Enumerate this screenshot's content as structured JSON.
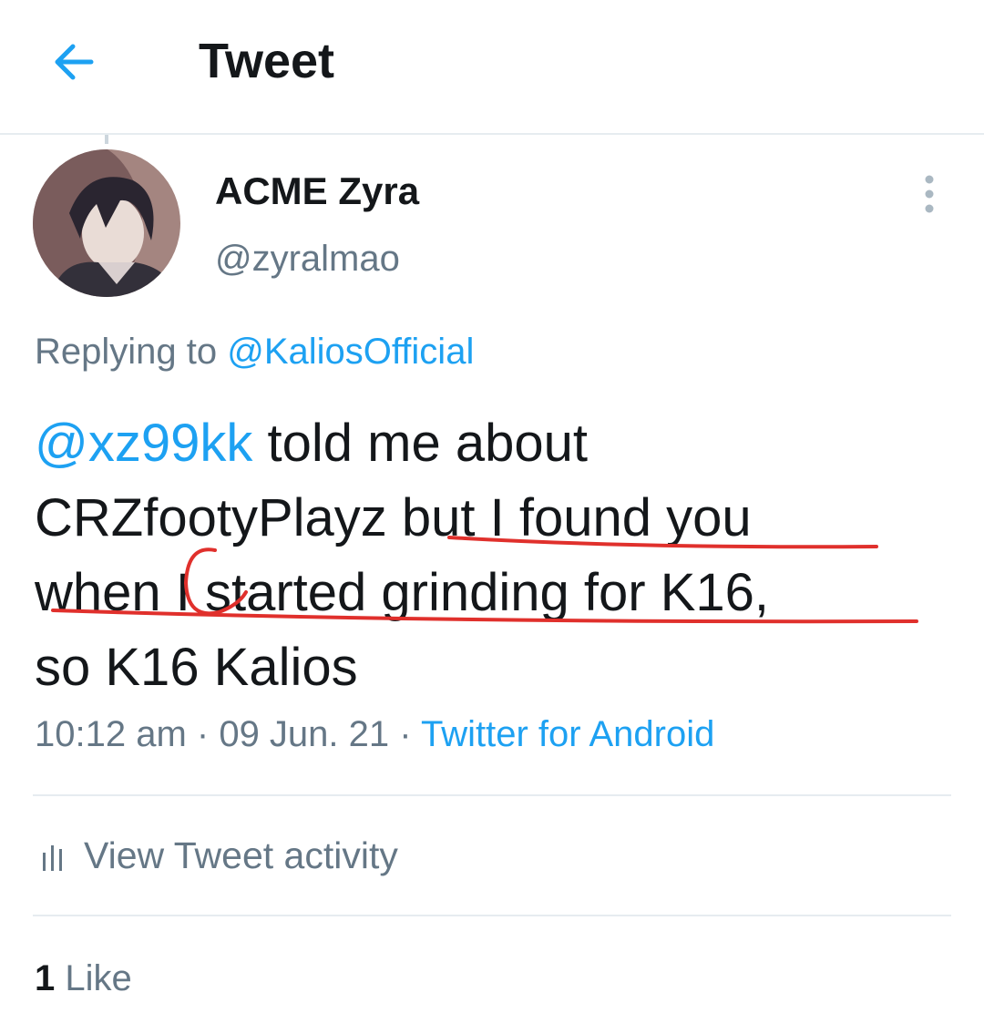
{
  "header": {
    "title": "Tweet",
    "back_icon": "arrow-left-icon"
  },
  "colors": {
    "link": "#1da1f2",
    "secondary_text": "#657786",
    "primary_text": "#14171a",
    "annotation": "#e0302c"
  },
  "author": {
    "display_name": "ACME Zyra",
    "handle": "@zyralmao"
  },
  "reply": {
    "prefix": "Replying to",
    "to": "@KaliosOfficial"
  },
  "tweet": {
    "mention": "@xz99kk",
    "line1_rest": " told me about",
    "line2": "CRZfootyPlayz but I found you",
    "line3": "when I started grinding for K16,",
    "line4": "so K16 Kalios"
  },
  "meta": {
    "time": "10:12 am",
    "sep1": " · ",
    "date": "09 Jun. 21",
    "sep2": " · ",
    "source": "Twitter for Android"
  },
  "activity": {
    "label": "View Tweet activity",
    "icon": "bar-chart-icon"
  },
  "likes": {
    "count": "1",
    "label": " Like"
  },
  "more_icon": "more-vertical-icon"
}
